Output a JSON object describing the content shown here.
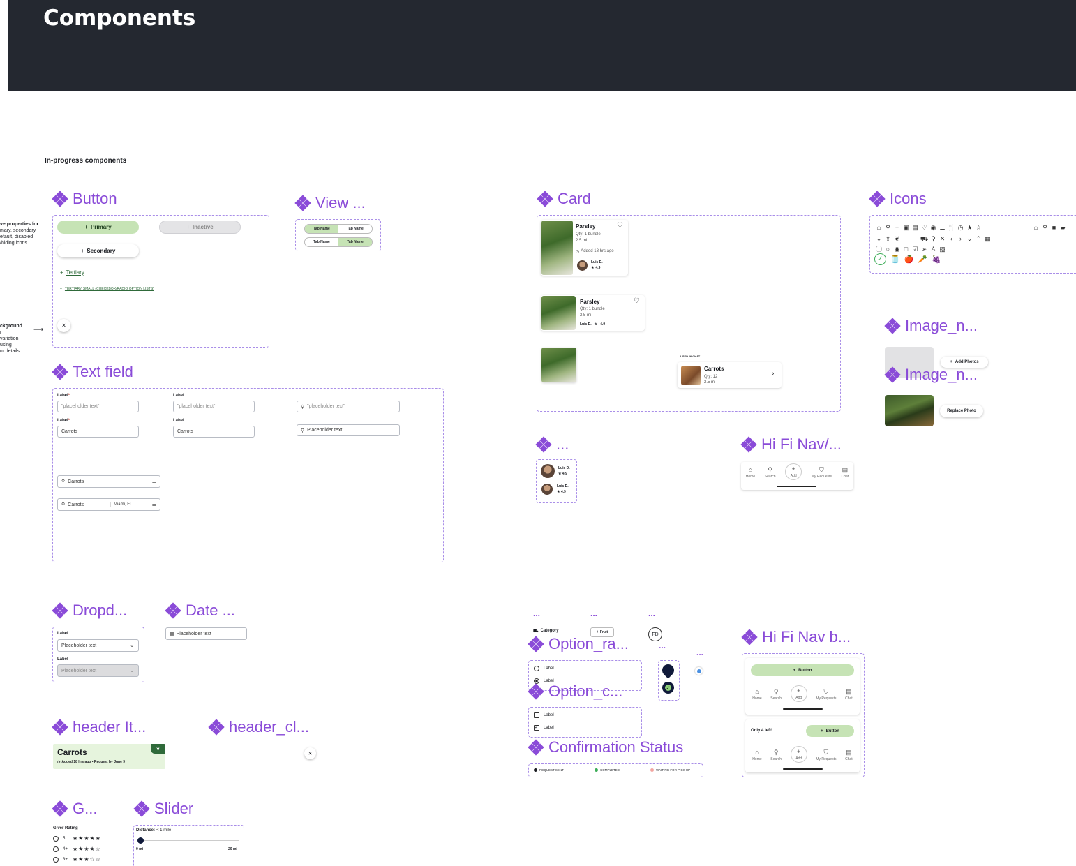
{
  "header": {
    "title": "Components"
  },
  "section": {
    "label": "In-progress components"
  },
  "button": {
    "title": "Button",
    "primary": "Primary",
    "inactive": "Inactive",
    "secondary": "Secondary",
    "tertiary": "Tertiary",
    "tertiary_small": "TERTIARY SMALL (CHECKBOX/RADIO OPTION LISTS)",
    "note1": [
      "ve properties for:",
      "mary, secondary",
      "efault, disabled",
      "/hiding icons"
    ],
    "note2": [
      "ckground",
      "r",
      "variation",
      "using",
      "m details"
    ]
  },
  "view": {
    "title": "View ...",
    "tab": "Tab Name"
  },
  "card": {
    "title": "Card",
    "name": "Parsley",
    "qty": "Qty: 1 bundle",
    "distance": "2.5 mi",
    "added": "Added 18 hrs ago",
    "user": "Luis D.",
    "rating": "4.9",
    "used_in_chat": "USED IN CHAT",
    "chat_item": "Carrots",
    "chat_qty": "Qty: 12",
    "chat_dist": "2.5 mi"
  },
  "icons": {
    "title": "Icons"
  },
  "image1": {
    "title": "Image_n...",
    "add": "Add Photos"
  },
  "image2": {
    "title": "Image_n...",
    "replace": "Replace Photo"
  },
  "textfield": {
    "title": "Text field",
    "label": "Label",
    "placeholder_quoted": "\"placeholder text\"",
    "value": "Carrots",
    "placeholder": "Placeholder text",
    "location": "Miami, FL"
  },
  "avatar_comp": {
    "title": "...",
    "user": "Luis D.",
    "rating": "4.9"
  },
  "hifinav": {
    "title": "Hi Fi Nav/...",
    "items": [
      "Home",
      "Search",
      "Add",
      "My Requests",
      "Chat"
    ]
  },
  "dropdown": {
    "title": "Dropd...",
    "label": "Label",
    "placeholder": "Placeholder text"
  },
  "date": {
    "title": "Date ...",
    "placeholder": "Placeholder text"
  },
  "chips": {
    "dots": "...",
    "category": "Category",
    "fruit": "Fruit",
    "initials": "FD"
  },
  "option_radio": {
    "title": "Option_ra...",
    "label": "Label"
  },
  "option_check": {
    "title": "Option_c...",
    "label": "Label"
  },
  "confirmation": {
    "title": "Confirmation Status",
    "items": [
      {
        "label": "REQUEST SENT",
        "color": "#1b1d22"
      },
      {
        "label": "COMPLETED",
        "color": "#3fae5a"
      },
      {
        "label": "WAITING FOR PICK UP",
        "color": "#f2a5a0"
      }
    ]
  },
  "hifinavb": {
    "title": "Hi Fi Nav b...",
    "button": "Button",
    "only_left": "Only 4 left!"
  },
  "header_item": {
    "title": "header It...",
    "name": "Carrots",
    "meta": "Added 18 hrs ago • Request by June 9"
  },
  "header_close": {
    "title": "header_cl..."
  },
  "giver": {
    "title": "G...",
    "label": "Giver Rating",
    "rows": [
      "5",
      "4+",
      "3+"
    ]
  },
  "slider": {
    "title": "Slider",
    "label": "Distance:",
    "value": "< 1 mile",
    "min": "0 mi",
    "max": "20 mi"
  },
  "colors": {
    "accent": "#8a4bd8",
    "primary_green": "#c6e3b5",
    "dark": "#242830"
  }
}
